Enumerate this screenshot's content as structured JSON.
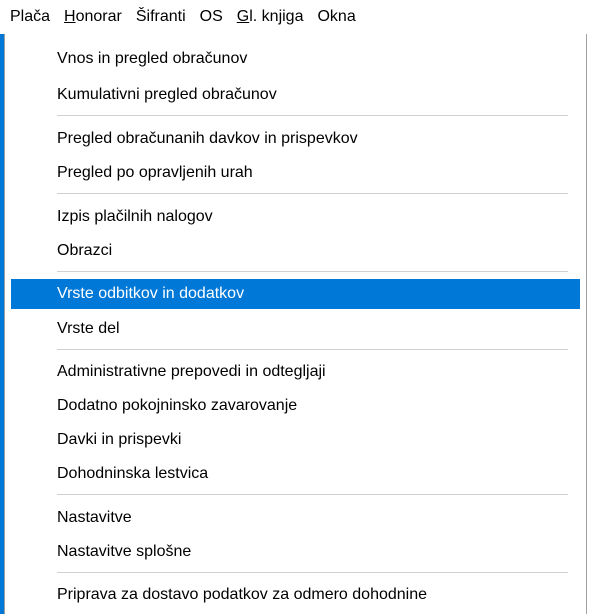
{
  "menubar": {
    "items": [
      {
        "label": "Plača",
        "underline": ""
      },
      {
        "label_pre": "",
        "underline": "H",
        "label_post": "onorar"
      },
      {
        "label": "Šifranti"
      },
      {
        "label": "OS"
      },
      {
        "label_pre": "",
        "underline": "G",
        "label_post": "l. knjiga"
      },
      {
        "label": "Okna"
      }
    ]
  },
  "dropdown": {
    "items": [
      {
        "label": "Vnos in pregled obračunov"
      },
      {
        "label": "Kumulativni pregled obračunov"
      },
      {
        "label": "Pregled obračunanih davkov in prispevkov"
      },
      {
        "label": "Pregled po opravljenih urah"
      },
      {
        "label": "Izpis plačilnih nalogov"
      },
      {
        "label": "Obrazci"
      },
      {
        "label": "Vrste odbitkov in dodatkov"
      },
      {
        "label": "Vrste del"
      },
      {
        "label": "Administrativne prepovedi in odtegljaji"
      },
      {
        "label": "Dodatno pokojninsko zavarovanje"
      },
      {
        "label": "Davki in prispevki"
      },
      {
        "label": "Dohodninska lestvica"
      },
      {
        "label": "Nastavitve"
      },
      {
        "label": "Nastavitve splošne"
      },
      {
        "label": "Priprava za dostavo podatkov za odmero dohodnine"
      }
    ],
    "selected_index": 6,
    "selected_color": "#0078d7"
  }
}
